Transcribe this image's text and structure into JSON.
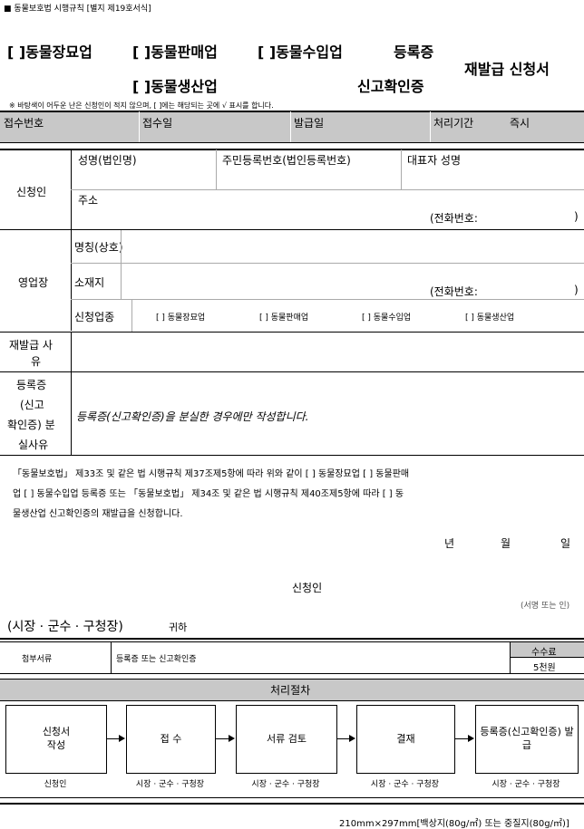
{
  "form_header": "■ 동물보호법 시행규칙 [별지 제19호서식]",
  "title": {
    "line1_a": "[ ]동물장묘업",
    "line1_b": "[ ]동물판매업",
    "line1_c": "[ ]동물수입업",
    "line1_d": "등록증",
    "line2_a": "[ ]동물생산업",
    "line2_b": "신고확인증",
    "right": "재발급 신청서"
  },
  "instruction": "※ 바탕색이 어두운 난은 신청인이 적지 않으며, [ ]에는 해당되는 곳에 √ 표시를 합니다.",
  "receipt": {
    "number_label": "접수번호",
    "date_label": "접수일",
    "issue_label": "발급일",
    "period_label": "처리기간",
    "period_value": "즉시"
  },
  "applicant": {
    "section_label": "신청인",
    "name_label": "성명(법인명)",
    "id_label": "주민등록번호(법인등록번호)",
    "rep_label": "대표자 성명",
    "address_label": "주소",
    "phone_label": "(전화번호:",
    "phone_close": ")"
  },
  "business": {
    "section_label": "영업장",
    "name_label": "명칭(상호)",
    "location_label": "소재지",
    "phone_label": "(전화번호:",
    "phone_close": ")",
    "type_label": "신청업종",
    "types": [
      "[ ] 동물장묘업",
      "[ ] 동물판매업",
      "[ ] 동물수입업",
      "[ ] 동물생산업"
    ]
  },
  "reissue_reason": {
    "label_1": "재발급 사",
    "label_2": "유"
  },
  "loss_reason": {
    "label_1": "등록증",
    "label_2": "(신고",
    "label_3": "확인증) 분",
    "label_4": "실사유",
    "note": "등록증(신고확인증)을 분실한 경우에만 작성합니다."
  },
  "statement": {
    "line1": "「동물보호법」 제33조 및 같은 법 시행규칙 제37조제5항에 따라 위와 같이 [ ] 동물장묘업 [ ] 동물판매",
    "line2": "업 [ ] 동물수입업 등록증 또는 「동물보호법」 제34조 및 같은 법 시행규칙 제40조제5항에 따라 [ ] 동",
    "line3": "물생산업 신고확인증의 재발급을 신청합니다."
  },
  "date": {
    "year": "년",
    "month": "월",
    "day": "일"
  },
  "signature": {
    "label": "신청인",
    "hint": "(서명 또는 인)"
  },
  "recipient": {
    "main": "(시장 · 군수 · 구청장)",
    "suffix": "귀하"
  },
  "attachment": {
    "label": "첨부서류",
    "value": "등록증 또는 신고확인증",
    "fee_label": "수수료",
    "fee_value": "5천원"
  },
  "procedure": {
    "title": "처리절차",
    "steps": [
      {
        "box_1": "신청서",
        "box_2": "작성",
        "who": "신청인"
      },
      {
        "box_1": "접  수",
        "box_2": "",
        "who": "시장 · 군수 · 구청장"
      },
      {
        "box_1": "서류 검토",
        "box_2": "",
        "who": "시장 · 군수 · 구청장"
      },
      {
        "box_1": "결재",
        "box_2": "",
        "who": "시장 · 군수 · 구청장"
      },
      {
        "box_1": "등록증(신고확인증) 발",
        "box_2": "급",
        "who": "시장 · 군수 · 구청장"
      }
    ]
  },
  "footer": "210mm×297mm[백상지(80g/㎡) 또는 중질지(80g/㎡)]"
}
